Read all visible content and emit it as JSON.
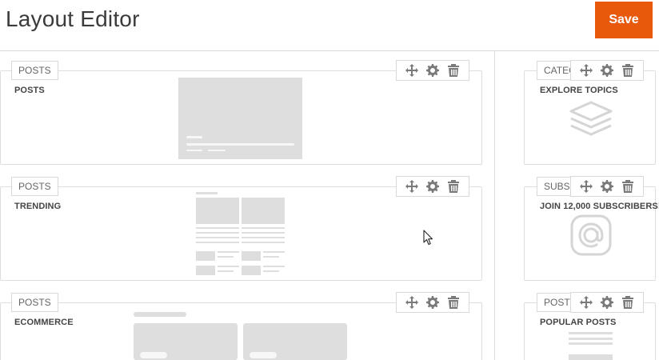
{
  "header": {
    "title": "Layout Editor",
    "save_label": "Save"
  },
  "main_blocks": [
    {
      "tag": "POSTS",
      "title": "POSTS"
    },
    {
      "tag": "POSTS",
      "title": "TRENDING"
    },
    {
      "tag": "POSTS",
      "title": "ECOMMERCE"
    }
  ],
  "side_blocks": [
    {
      "tag": "CATEG",
      "title": "EXPLORE TOPICS",
      "icon": "layers-icon"
    },
    {
      "tag": "SUBSC",
      "title": "JOIN 12,000 SUBSCRIBERS!",
      "icon": "instagram-at-icon"
    },
    {
      "tag": "POSTS",
      "title": "POPULAR POSTS"
    }
  ],
  "toolbar_icons": [
    "move-icon",
    "gear-icon",
    "trash-icon"
  ],
  "colors": {
    "accent": "#e8590c",
    "placeholder": "#dedede"
  }
}
